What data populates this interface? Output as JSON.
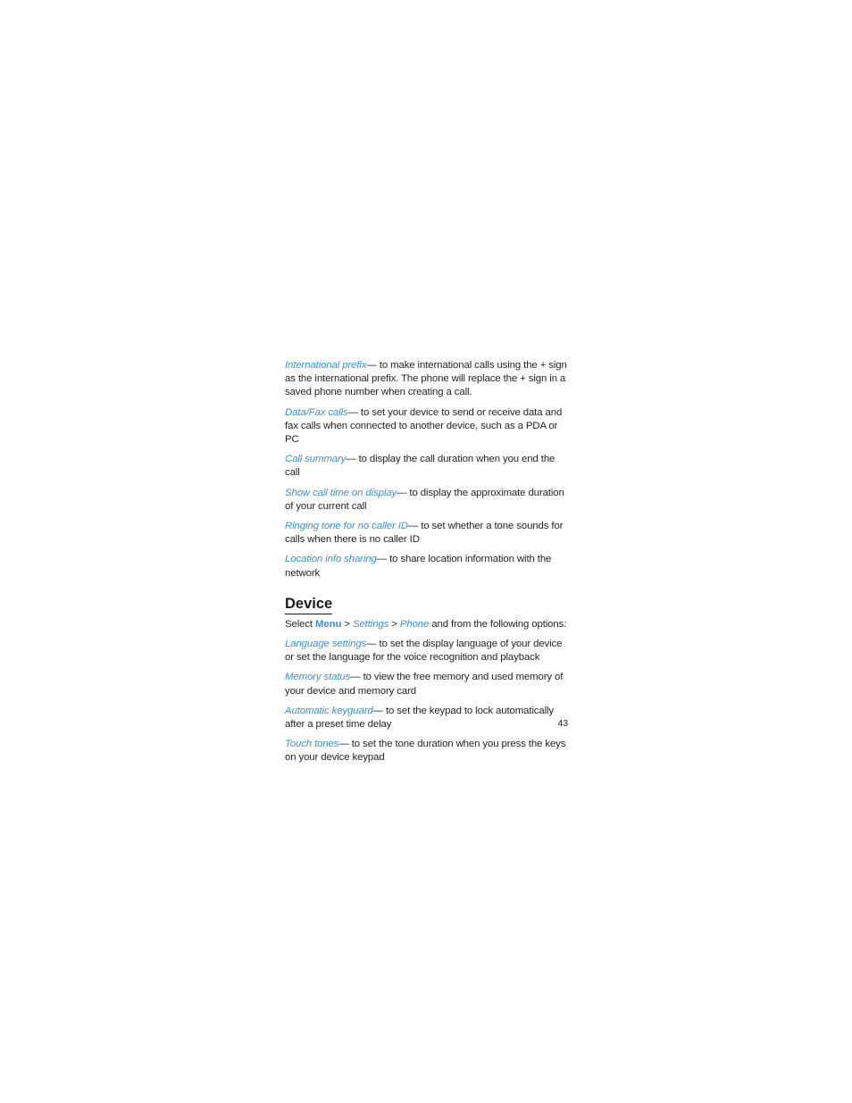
{
  "document": {
    "page_number": "43",
    "colors": {
      "term_blue": "#3c8fd9",
      "body_text": "#231f20",
      "heading": "#1a1a1a",
      "background": "#ffffff"
    }
  },
  "call_settings": {
    "entries": [
      {
        "term": "International prefix",
        "dash": "—",
        "description": "to make international calls using the + sign as the international prefix. The phone will replace the + sign in a saved phone number when creating a call."
      },
      {
        "term": "Data/Fax calls",
        "dash": "—",
        "description": "to set your device to send or receive data and fax calls when connected to another device, such as a PDA or PC"
      },
      {
        "term": "Call summary",
        "dash": "—",
        "description": "to display the call duration when you end the call"
      },
      {
        "term": "Show call time on display",
        "dash": "—",
        "description": "to display the approximate duration of your current call"
      },
      {
        "term": "Ringing tone for no caller ID",
        "dash": "—",
        "description": "to set whether a tone sounds for calls when there is no caller ID"
      },
      {
        "term": "Location info sharing",
        "dash": "—",
        "description": "to share location information with the network"
      }
    ]
  },
  "device_section": {
    "heading": "Device",
    "select_line": {
      "prefix": "Select ",
      "item1": "Menu",
      "sep1": " > ",
      "item2": "Settings",
      "sep2": " > ",
      "item3": "Phone",
      "suffix": " and from the following options:"
    },
    "entries": [
      {
        "term": "Language settings",
        "dash": "—",
        "description": "to set the display language of your device or set the language for the voice recognition and playback"
      },
      {
        "term": "Memory status",
        "dash": "—",
        "description": "to view the free memory and used memory of your device and memory card"
      },
      {
        "term": "Automatic keyguard",
        "dash": "—",
        "description": "to set the keypad to lock automatically after a preset time delay"
      },
      {
        "term": "Touch tones",
        "dash": "—",
        "description": "to set the tone duration when you press the keys on your device keypad"
      }
    ]
  }
}
